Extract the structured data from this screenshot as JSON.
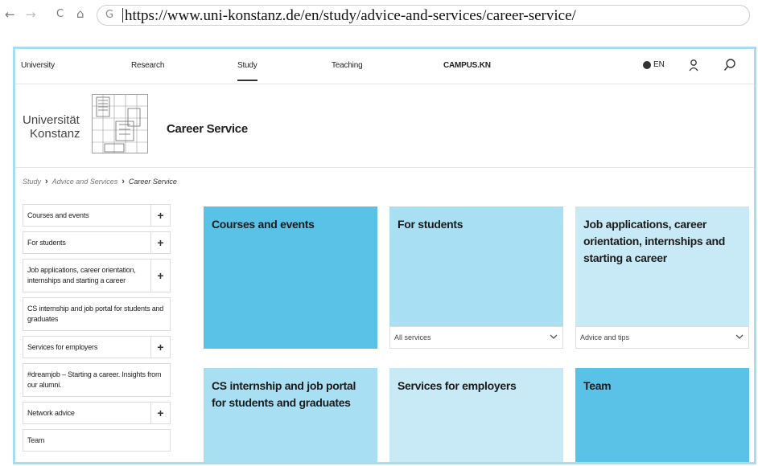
{
  "browser": {
    "back": "←",
    "forward": "→",
    "reload": "C",
    "home": "⌂",
    "site_icon": "G",
    "url": "https://www.uni-konstanz.de/en/study/advice-and-services/career-service/"
  },
  "topnav": {
    "items": [
      "University",
      "Research",
      "Study",
      "Teaching"
    ],
    "campus": "CAMPUS.KN",
    "lang": "EN",
    "icons": [
      "globe-icon",
      "user-icon",
      "search-icon"
    ]
  },
  "header": {
    "logo_line1": "Universität",
    "logo_line2": "Konstanz",
    "title": "Career Service"
  },
  "breadcrumb": {
    "items": [
      "Study",
      "Advice and Services",
      "Career Service"
    ],
    "separator": "›"
  },
  "sidebar": {
    "items": [
      {
        "label": "Courses and events",
        "plus": "+"
      },
      {
        "label": "For students",
        "plus": "+"
      },
      {
        "label": "Job applications, career orientation, internships and starting a career",
        "plus": "+"
      },
      {
        "label": "CS internship and job portal for students and graduates",
        "plus": ""
      },
      {
        "label": "Services for employers",
        "plus": "+"
      },
      {
        "label": "#dreamjob – Starting a career. Insights from our alumni.",
        "plus": ""
      },
      {
        "label": "Network advice",
        "plus": "+"
      },
      {
        "label": "Team",
        "plus": ""
      }
    ]
  },
  "tiles": [
    {
      "title": "Courses and events",
      "select": ""
    },
    {
      "title": "For students",
      "select": "All services"
    },
    {
      "title": "Job applications, career orientation, internships and starting a career",
      "select": "Advice and tips"
    },
    {
      "title": "CS internship and job portal for students and graduates",
      "select": ""
    },
    {
      "title": "Services for employers",
      "select": ""
    },
    {
      "title": "Team",
      "select": ""
    }
  ],
  "colors": {
    "tile_dark": "#5bc2e7",
    "tile_light": "#a9dff2",
    "tile_lighter": "#c8eaf6",
    "frame": "#a9dcee"
  }
}
